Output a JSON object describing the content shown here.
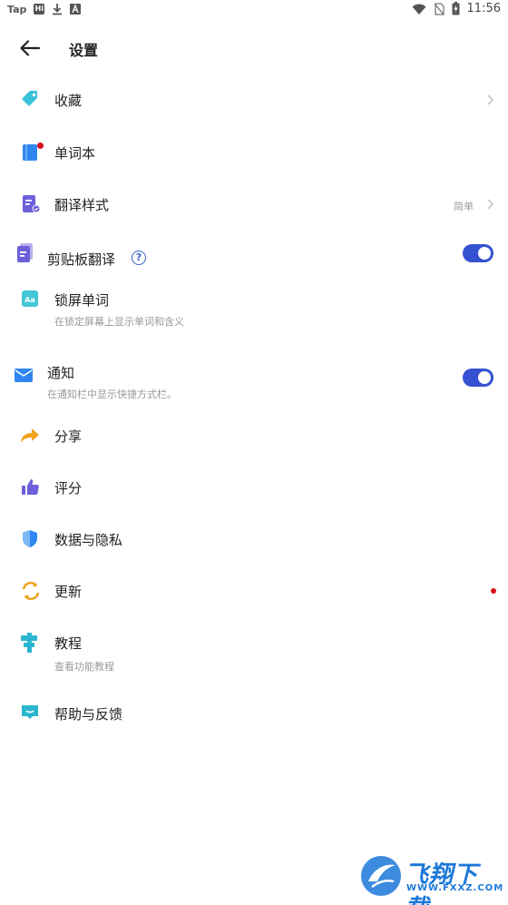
{
  "status_bar": {
    "left_label": "Tap",
    "box_label": "Hi",
    "time": "11:56"
  },
  "header": {
    "title": "设置"
  },
  "items": [
    {
      "label": "收藏",
      "icon": "tag-icon"
    },
    {
      "label": "单词本",
      "icon": "notebook-icon",
      "badge": true
    },
    {
      "label": "翻译样式",
      "icon": "document-style-icon",
      "value": "简单"
    },
    {
      "label": "剪贴板翻译",
      "icon": "clipboard-icon",
      "toggle": true
    },
    {
      "label": "锁屏单词",
      "icon": "aa-icon",
      "subtitle": "在锁定屏幕上显示单词和含义"
    },
    {
      "label": "通知",
      "icon": "mail-icon",
      "subtitle": "在通知栏中显示快捷方式栏。",
      "toggle": true
    },
    {
      "label": "分享",
      "icon": "share-arrow-icon"
    },
    {
      "label": "评分",
      "icon": "thumbs-up-icon"
    },
    {
      "label": "数据与隐私",
      "icon": "shield-icon"
    },
    {
      "label": "更新",
      "icon": "refresh-icon",
      "badge": true
    },
    {
      "label": "教程",
      "icon": "signpost-icon",
      "subtitle": "查看功能教程"
    },
    {
      "label": "帮助与反馈",
      "icon": "feedback-icon"
    }
  ],
  "watermark": {
    "brand": "飞翔下载",
    "url": "WWW.FXXZ.COM"
  },
  "colors": {
    "accent": "#3451d1",
    "badge": "#d80f1e"
  }
}
